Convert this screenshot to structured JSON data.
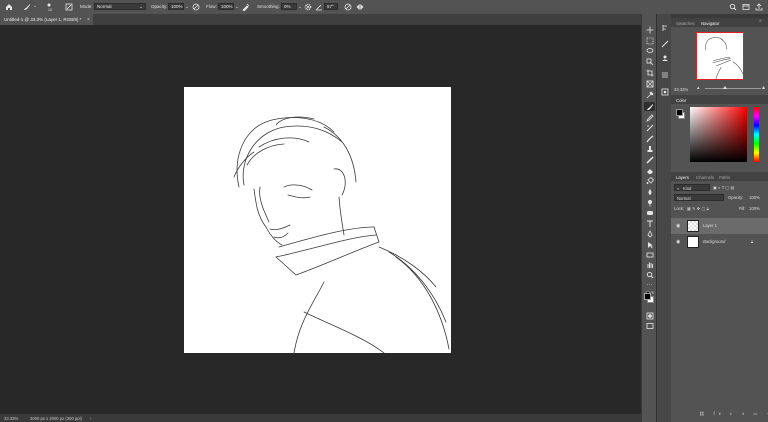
{
  "options_bar": {
    "mode_label": "Mode:",
    "mode_value": "Normal",
    "opacity_label": "Opacity:",
    "opacity_value": "100%",
    "flow_label": "Flow:",
    "flow_value": "100%",
    "smoothing_label": "Smoothing:",
    "smoothing_value": "0%",
    "angle_value": "57°",
    "brush_size": "10"
  },
  "document_tab": {
    "title": "Untitled-1 @ 33.3% (Layer 1, RGB/8) *"
  },
  "status_bar": {
    "zoom": "33.33%",
    "doc_size": "2000 px x 2000 px (300 ppi)"
  },
  "navigator_panel": {
    "tabs": [
      "Swatches",
      "Navigator"
    ],
    "zoom": "33.33%"
  },
  "color_panel": {
    "tab": "Color",
    "foreground": "#000000",
    "background": "#ffffff",
    "picker_hue": "#ff0000"
  },
  "layers_panel": {
    "tabs": [
      "Layers",
      "Channels",
      "Paths"
    ],
    "filter_label": "Kind",
    "blend_mode": "Normal",
    "opacity_label": "Opacity:",
    "opacity_value": "100%",
    "lock_label": "Lock:",
    "fill_label": "Fill:",
    "fill_value": "100%",
    "layers": [
      {
        "name": "Layer 1",
        "selected": true,
        "locked": false
      },
      {
        "name": "Background",
        "selected": false,
        "locked": true
      }
    ]
  },
  "icons": [
    "home-icon",
    "brush-tool-icon",
    "brush-preset-icon",
    "brush-settings-icon",
    "airbrush-icon",
    "pressure-opacity-icon",
    "gear-icon",
    "angle-icon",
    "pressure-size-icon",
    "search-icon",
    "workspace-icon",
    "share-icon",
    "close-tab-icon"
  ]
}
